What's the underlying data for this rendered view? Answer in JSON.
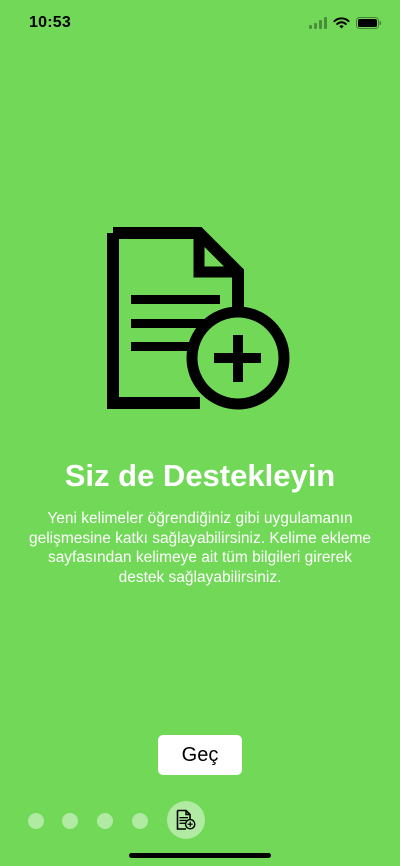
{
  "status_bar": {
    "time": "10:53",
    "icons": [
      "cellular-signal-icon",
      "wifi-icon",
      "battery-icon"
    ]
  },
  "onboarding": {
    "illustration_icon": "document-add-icon",
    "title": "Siz de Destekleyin",
    "description": "Yeni kelimeler öğrendiğiniz gibi uygulamanın gelişmesine katkı sağlayabilirsiniz. Kelime ekleme sayfasından kelimeye ait tüm bilgileri girerek destek sağlayabilirsiniz."
  },
  "actions": {
    "skip_label": "Geç"
  },
  "pager": {
    "total_pages": 5,
    "current_page": 5,
    "current_page_icon": "document-add-icon"
  },
  "colors": {
    "background": "#71d957",
    "text": "#ffffff",
    "icon": "#000000",
    "button_background": "#ffffff"
  }
}
